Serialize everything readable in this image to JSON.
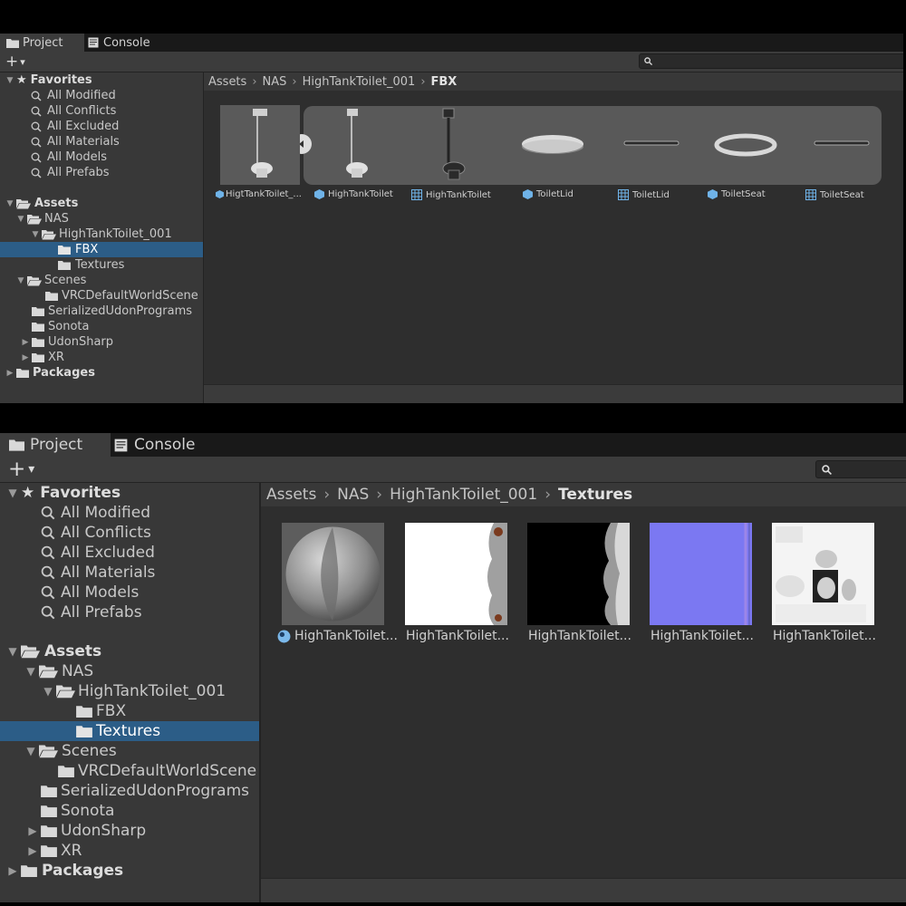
{
  "top": {
    "tabs": [
      {
        "label": "Project",
        "icon": "folder-icon"
      },
      {
        "label": "Console",
        "icon": "console-icon"
      }
    ],
    "toolbar": {
      "add_label": "+",
      "add_dropdown": "▾",
      "search_value": ""
    },
    "favorites": {
      "label": "Favorites",
      "items": [
        "All Modified",
        "All Conflicts",
        "All Excluded",
        "All Materials",
        "All Models",
        "All Prefabs"
      ]
    },
    "tree": {
      "assets": "Assets",
      "nas": "NAS",
      "toilet_folder": "HighTankToilet_001",
      "fbx": "FBX",
      "textures": "Textures",
      "scenes": "Scenes",
      "vrc_scene": "VRCDefaultWorldScene",
      "serialized": "SerializedUdonPrograms",
      "sonota": "Sonota",
      "udonsharp": "UdonSharp",
      "xr": "XR",
      "packages": "Packages"
    },
    "selected_folder": "FBX",
    "breadcrumb": [
      "Assets",
      "NAS",
      "HighTankToilet_001",
      "FBX"
    ],
    "assets": [
      {
        "name": "HigtTankToilet_...",
        "icon": "prefab-icon",
        "thumb": "toilet-model"
      },
      {
        "name": "HighTankToilet",
        "icon": "prefab-icon",
        "thumb": "toilet-model"
      },
      {
        "name": "HighTankToilet",
        "icon": "mesh-icon",
        "thumb": "toilet-mesh"
      },
      {
        "name": "ToiletLid",
        "icon": "prefab-icon",
        "thumb": "lid"
      },
      {
        "name": "ToiletLid",
        "icon": "mesh-icon",
        "thumb": "lid-flat"
      },
      {
        "name": "ToiletSeat",
        "icon": "prefab-icon",
        "thumb": "seat"
      },
      {
        "name": "ToiletSeat",
        "icon": "mesh-icon",
        "thumb": "seat-flat"
      }
    ]
  },
  "bottom": {
    "tabs": [
      {
        "label": "Project",
        "icon": "folder-icon"
      },
      {
        "label": "Console",
        "icon": "console-icon"
      }
    ],
    "toolbar": {
      "add_label": "+",
      "add_dropdown": "▾",
      "search_value": ""
    },
    "favorites": {
      "label": "Favorites",
      "items": [
        "All Modified",
        "All Conflicts",
        "All Excluded",
        "All Materials",
        "All Models",
        "All Prefabs"
      ]
    },
    "tree": {
      "assets": "Assets",
      "nas": "NAS",
      "toilet_folder": "HighTankToilet_001",
      "fbx": "FBX",
      "textures": "Textures",
      "scenes": "Scenes",
      "vrc_scene": "VRCDefaultWorldScene",
      "serialized": "SerializedUdonPrograms",
      "sonota": "Sonota",
      "udonsharp": "UdonSharp",
      "xr": "XR",
      "packages": "Packages"
    },
    "selected_folder": "Textures",
    "breadcrumb": [
      "Assets",
      "NAS",
      "HighTankToilet_001",
      "Textures"
    ],
    "assets": [
      {
        "name": "HighTankToilet...",
        "icon": "material-icon",
        "thumb": "material-sphere"
      },
      {
        "name": "HighTankToilet...",
        "icon": "",
        "thumb": "albedo-texture"
      },
      {
        "name": "HighTankToilet...",
        "icon": "",
        "thumb": "mask-texture"
      },
      {
        "name": "HighTankToilet...",
        "icon": "",
        "thumb": "normal-map",
        "color": "#7b78f2"
      },
      {
        "name": "HighTankToilet...",
        "icon": "",
        "thumb": "occlusion-texture"
      }
    ]
  }
}
